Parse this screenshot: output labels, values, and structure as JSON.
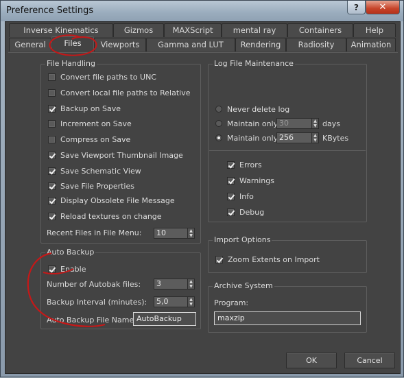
{
  "window": {
    "title": "Preference Settings",
    "help_label": "?",
    "close_label": "✕"
  },
  "tabs_row1": [
    "Inverse Kinematics",
    "Gizmos",
    "MAXScript",
    "mental ray",
    "Containers",
    "Help"
  ],
  "tabs_row2": [
    "General",
    "Files",
    "Viewports",
    "Gamma and LUT",
    "Rendering",
    "Radiosity",
    "Animation"
  ],
  "active_tab": "Files",
  "file_handling": {
    "title": "File Handling",
    "options": [
      {
        "label": "Convert file paths to UNC",
        "checked": false
      },
      {
        "label": "Convert local file paths to Relative",
        "checked": false
      },
      {
        "label": "Backup on Save",
        "checked": true
      },
      {
        "label": "Increment on Save",
        "checked": false
      },
      {
        "label": "Compress on Save",
        "checked": false
      },
      {
        "label": "Save Viewport Thumbnail Image",
        "checked": true
      },
      {
        "label": "Save Schematic View",
        "checked": true
      },
      {
        "label": "Save File Properties",
        "checked": true
      },
      {
        "label": "Display Obsolete File Message",
        "checked": true
      },
      {
        "label": "Reload textures on change",
        "checked": true
      }
    ],
    "recent_files_label": "Recent Files in File Menu:",
    "recent_files_value": "10"
  },
  "auto_backup": {
    "title": "Auto Backup",
    "enable_label": "Enable",
    "enable_checked": true,
    "num_files_label": "Number of Autobak files:",
    "num_files_value": "3",
    "interval_label": "Backup Interval (minutes):",
    "interval_value": "5,0",
    "name_label": "Auto Backup File Name:",
    "name_value": "AutoBackup"
  },
  "log_file": {
    "title": "Log File Maintenance",
    "never_delete_label": "Never delete log",
    "maintain_label_1": "Maintain only",
    "maintain_days_value": "30",
    "days_unit": "days",
    "maintain_label_2": "Maintain only",
    "maintain_kb_value": "256",
    "kb_unit": "KBytes",
    "selected": "kbytes",
    "levels": [
      {
        "label": "Errors",
        "checked": true
      },
      {
        "label": "Warnings",
        "checked": true
      },
      {
        "label": "Info",
        "checked": true
      },
      {
        "label": "Debug",
        "checked": true
      }
    ]
  },
  "import_options": {
    "title": "Import Options",
    "zoom_label": "Zoom Extents on Import",
    "zoom_checked": true
  },
  "archive": {
    "title": "Archive System",
    "program_label": "Program:",
    "program_value": "maxzip"
  },
  "buttons": {
    "ok": "OK",
    "cancel": "Cancel"
  },
  "spin_up": "▲",
  "spin_down": "▼",
  "annotation_color": "#c41818"
}
